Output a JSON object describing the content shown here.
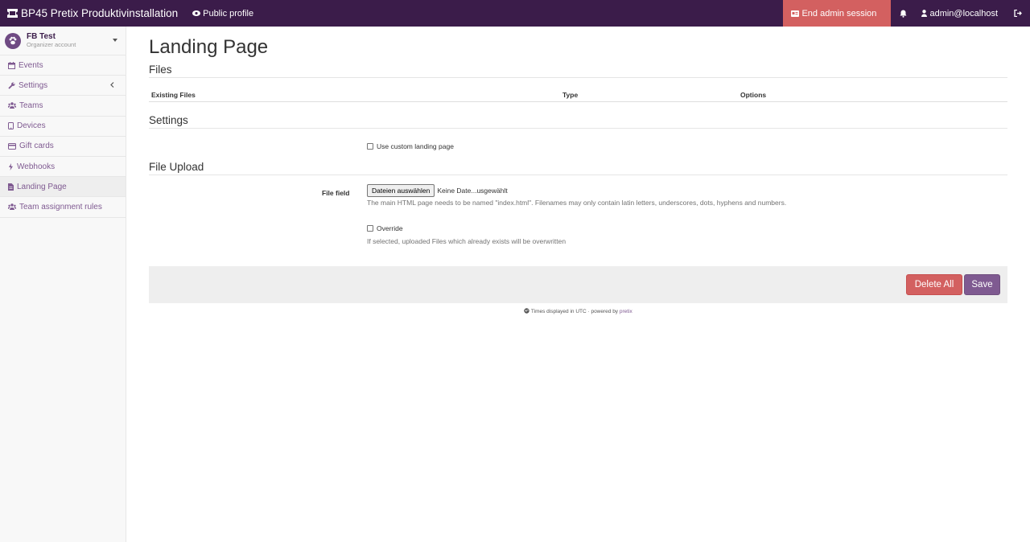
{
  "topbar": {
    "brand": "BP45 Pretix Produktivinstallation",
    "public_profile": "Public profile",
    "end_admin": "End admin session",
    "user": "admin@localhost"
  },
  "sidebar": {
    "org_name": "FB Test",
    "org_sub": "Organizer account",
    "items": [
      {
        "label": "Events",
        "icon": "calendar-icon"
      },
      {
        "label": "Settings",
        "icon": "wrench-icon"
      },
      {
        "label": "Teams",
        "icon": "group-icon"
      },
      {
        "label": "Devices",
        "icon": "tablet-icon"
      },
      {
        "label": "Gift cards",
        "icon": "credit-card-icon"
      },
      {
        "label": "Webhooks",
        "icon": "bolt-icon"
      },
      {
        "label": "Landing Page",
        "icon": "file-icon"
      },
      {
        "label": "Team assignment rules",
        "icon": "group-icon"
      }
    ]
  },
  "main": {
    "title": "Landing Page",
    "files_section": "Files",
    "table_headers": [
      "Existing Files",
      "Type",
      "Options"
    ],
    "settings_section": "Settings",
    "use_custom": "Use custom landing page",
    "upload_section": "File Upload",
    "file_field_label": "File field",
    "file_button": "Dateien auswählen",
    "file_none": "Keine Date...usgewählt",
    "file_help": "The main HTML page needs to be named \"index.html\". Filenames may only contain latin letters, underscores, dots, hyphens and numbers.",
    "override_label": "Override",
    "override_help": "If selected, uploaded Files which already exists will be overwritten",
    "delete_all": "Delete All",
    "save": "Save"
  },
  "footer": {
    "text": "Times displayed in UTC · powered by ",
    "link": "pretix"
  },
  "colors": {
    "navbar": "#3b1c4a",
    "accent": "#7f5a91",
    "danger": "#d36060"
  }
}
